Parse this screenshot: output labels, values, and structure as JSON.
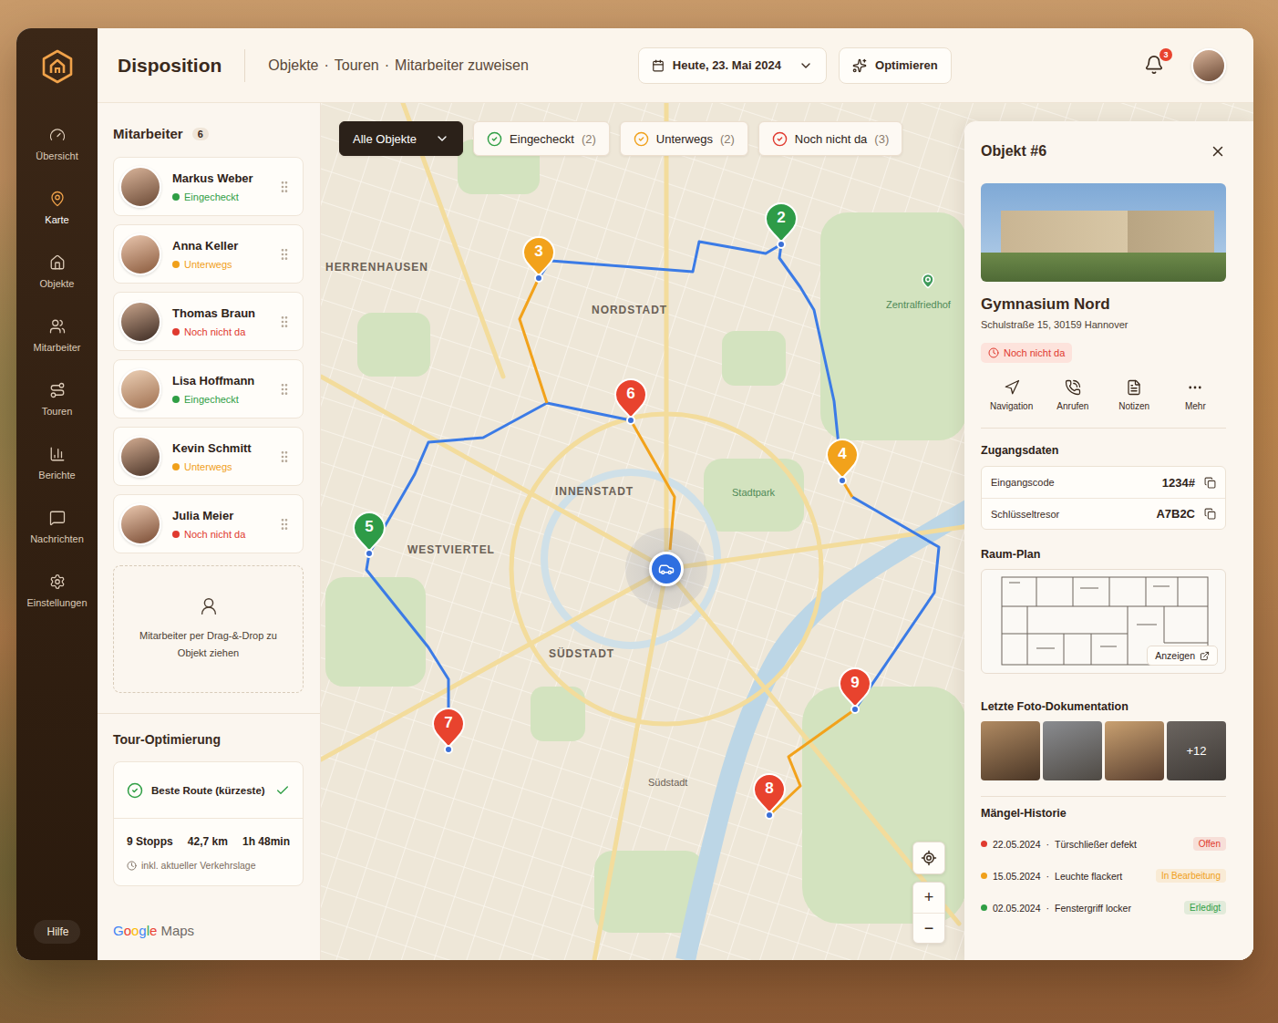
{
  "app": {
    "title": "Disposition",
    "breadcrumbs": [
      "Objekte",
      "Touren",
      "Mitarbeiter zuweisen"
    ],
    "breadcrumb_separator": "·",
    "date": "Heute, 23. Mai 2024",
    "optimize_button": "Optimieren",
    "notifications": "3"
  },
  "sidebar": {
    "items": [
      {
        "label": "Übersicht",
        "selected": false
      },
      {
        "label": "Karte",
        "selected": true
      },
      {
        "label": "Objekte",
        "selected": false
      },
      {
        "label": "Mitarbeiter",
        "selected": false
      },
      {
        "label": "Touren",
        "selected": false
      },
      {
        "label": "Berichte",
        "selected": false
      },
      {
        "label": "Nachrichten",
        "selected": false
      },
      {
        "label": "Einstellungen",
        "selected": false
      }
    ],
    "help": "Hilfe"
  },
  "employees": {
    "title": "Mitarbeiter",
    "count": "6",
    "items": [
      {
        "name": "Markus Weber",
        "status": "Eingecheckt",
        "color": "#2f9e44"
      },
      {
        "name": "Anna Keller",
        "status": "Unterwegs",
        "color": "#f0a01a"
      },
      {
        "name": "Thomas Braun",
        "status": "Noch nicht da",
        "color": "#e03a2f"
      },
      {
        "name": "Lisa Hoffmann",
        "status": "Eingecheckt",
        "color": "#2f9e44"
      },
      {
        "name": "Kevin Schmitt",
        "status": "Unterwegs",
        "color": "#f0a01a"
      },
      {
        "name": "Julia Meier",
        "status": "Noch nicht da",
        "color": "#e03a2f"
      }
    ]
  },
  "dropzone": {
    "text": "Mitarbeiter per Drag-&-Drop zu Objekt ziehen"
  },
  "optimization": {
    "title": "Tour-Optimierung",
    "option": "Beste Route (kürzeste)",
    "checked": true,
    "stats": [
      "9 Stopps",
      "42,7 km",
      "1h 48min"
    ],
    "note": "inkl. aktueller Verkehrslage"
  },
  "attribution": {
    "brand": "Google",
    "product": "Maps"
  },
  "filters": [
    {
      "label": "Alle Objekte",
      "kind": "dropdown",
      "selected": true
    },
    {
      "label": "Eingecheckt",
      "count": "(2)",
      "kind": "status",
      "selected": false,
      "color": "#2f9e44"
    },
    {
      "label": "Unterwegs",
      "count": "(2)",
      "kind": "status",
      "selected": false,
      "color": "#f0a01a"
    },
    {
      "label": "Noch nicht da",
      "count": "(3)",
      "kind": "status",
      "selected": false,
      "color": "#e03a2f"
    }
  ],
  "map": {
    "areas": [
      {
        "label": "HERRENHAUSEN",
        "kind": "district"
      },
      {
        "label": "NORDSTADT",
        "kind": "district"
      },
      {
        "label": "INNENSTADT",
        "kind": "district"
      },
      {
        "label": "WESTVIERTEL",
        "kind": "district"
      },
      {
        "label": "SÜDSTADT",
        "kind": "district"
      },
      {
        "label": "Stadtpark",
        "kind": "park"
      },
      {
        "label": "Zentralfriedhof",
        "kind": "park"
      },
      {
        "label": "Südstadt",
        "kind": "place"
      }
    ],
    "pins": [
      {
        "label": "3",
        "color": "#f2a21b"
      },
      {
        "label": "2",
        "color": "#2e9b47"
      },
      {
        "label": "6",
        "color": "#e8432e"
      },
      {
        "label": "4",
        "color": "#f2a21b"
      },
      {
        "label": "5",
        "color": "#2e9b47"
      },
      {
        "label": "7",
        "color": "#e8432e"
      },
      {
        "label": "8",
        "color": "#e8432e"
      },
      {
        "label": "9",
        "color": "#e8432e"
      }
    ],
    "zoom": [
      "+",
      "−"
    ]
  },
  "object": {
    "title": "Objekt #6",
    "name": "Gymnasium Nord",
    "address": "Schulstraße 15, 30159 Hannover",
    "status": "Noch nicht da",
    "status_color": "#e03a2f",
    "actions": [
      "Navigation",
      "Anrufen",
      "Notizen",
      "Mehr"
    ],
    "access": {
      "title": "Zugangsdaten",
      "rows": [
        {
          "label": "Eingangscode",
          "value": "1234#"
        },
        {
          "label": "Schlüsseltresor",
          "value": "A7B2C"
        }
      ]
    },
    "plan": {
      "title": "Raum-Plan",
      "button": "Anzeigen"
    },
    "photos": {
      "title": "Letzte Foto-Dokumentation",
      "more": "+12"
    },
    "defects": {
      "title": "Mängel-Historie",
      "separator": "·",
      "items": [
        {
          "date": "22.05.2024",
          "text": "Türschließer defekt",
          "status": "Offen",
          "color": "#e03a2f"
        },
        {
          "date": "15.05.2024",
          "text": "Leuchte flackert",
          "status": "In Bearbeitung",
          "color": "#f0a01a"
        },
        {
          "date": "02.05.2024",
          "text": "Fenstergriff locker",
          "status": "Erledigt",
          "color": "#2f9e44"
        }
      ]
    }
  }
}
